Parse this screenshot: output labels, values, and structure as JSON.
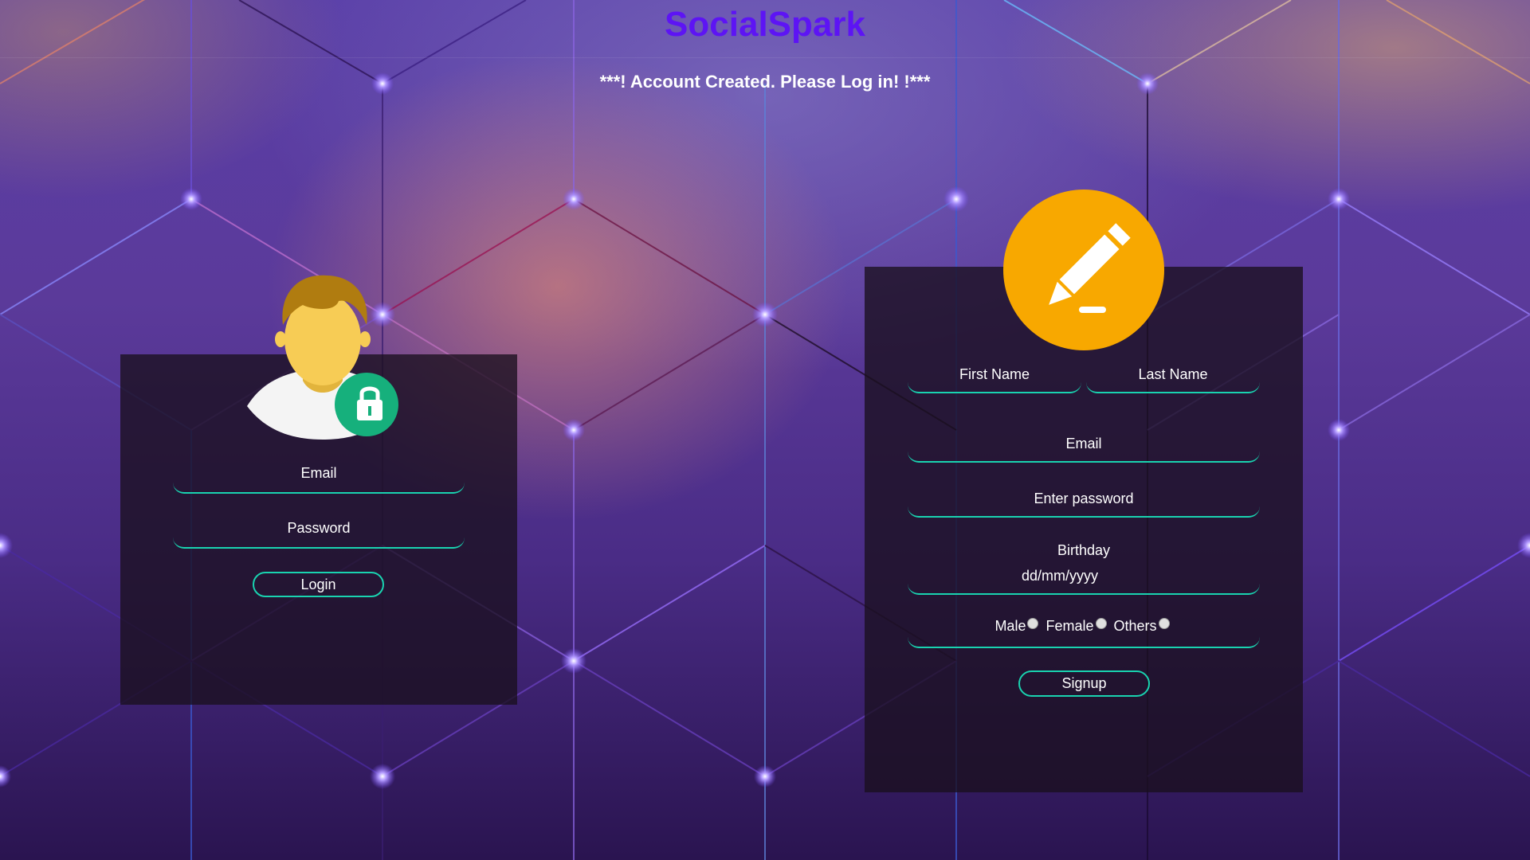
{
  "app": {
    "title": "SocialSpark"
  },
  "status": {
    "message": "***! Account Created. Please Log in! !***"
  },
  "login": {
    "email_label": "Email",
    "password_label": "Password",
    "login_button": "Login"
  },
  "signup": {
    "first_name_label": "First Name",
    "last_name_label": "Last Name",
    "email_label": "Email",
    "password_label": "Enter password",
    "birthday_label": "Birthday",
    "birthday_placeholder": "dd/mm/yyyy",
    "gender_options": [
      "Male",
      "Female",
      "Others"
    ],
    "signup_button": "Signup"
  },
  "colors": {
    "brand": "#5d14f4",
    "accent": "#19d3b0",
    "pencil_circle": "#f8a800",
    "lock_badge": "#16b07c"
  },
  "icons": [
    "user-avatar-icon",
    "lock-icon",
    "pencil-icon"
  ]
}
